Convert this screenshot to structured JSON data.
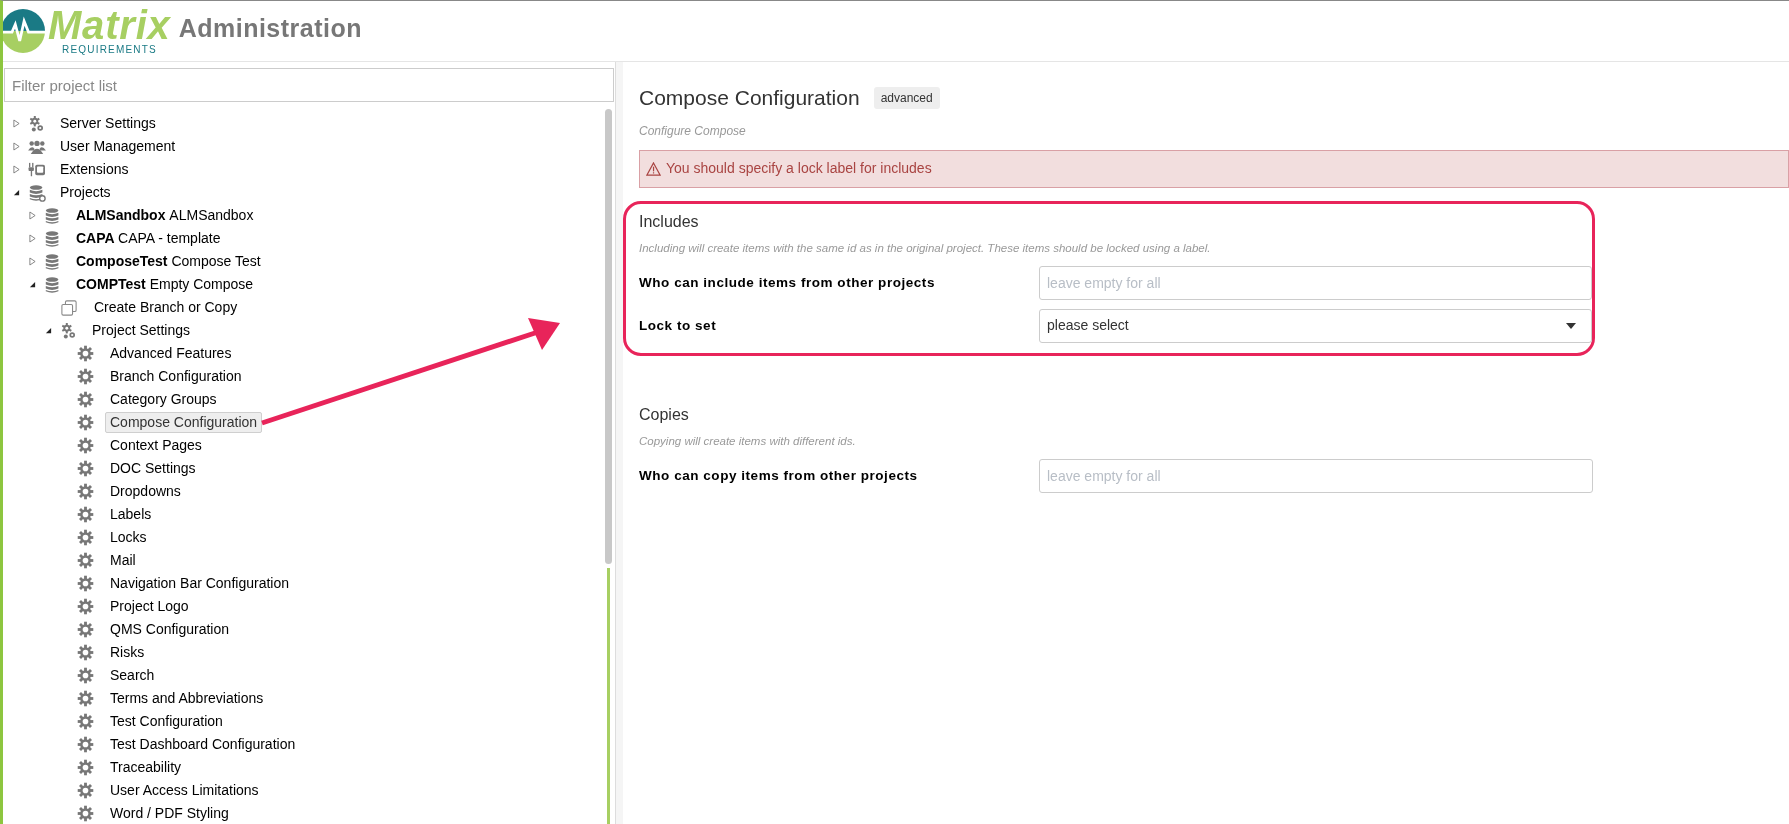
{
  "header": {
    "logo_word": "Matrix",
    "logo_sub": "REQUIREMENTS",
    "title": "Administration"
  },
  "sidebar": {
    "filter": {
      "placeholder": "Filter project list"
    },
    "tree": [
      {
        "kind": "gears",
        "label": "Server Settings",
        "expanded": false,
        "selected": false
      },
      {
        "kind": "users",
        "label": "User Management",
        "expanded": false,
        "selected": false
      },
      {
        "kind": "plug",
        "label": "Extensions",
        "expanded": false,
        "selected": false
      },
      {
        "kind": "database-gear",
        "label": "Projects",
        "expanded": true,
        "selected": false,
        "children": [
          {
            "kind": "database",
            "code": "ALMSandbox",
            "label": "ALMSandbox",
            "expanded": false,
            "selected": false
          },
          {
            "kind": "database",
            "code": "CAPA",
            "label": "CAPA - template",
            "expanded": false,
            "selected": false
          },
          {
            "kind": "database",
            "code": "ComposeTest",
            "label": "Compose Test",
            "expanded": false,
            "selected": false
          },
          {
            "kind": "database",
            "code": "COMPTest",
            "label": "Empty Compose",
            "expanded": true,
            "selected": false,
            "children": [
              {
                "kind": "copy",
                "label": "Create Branch or Copy",
                "selected": false
              },
              {
                "kind": "gears",
                "label": "Project Settings",
                "expanded": true,
                "selected": false,
                "children": [
                  {
                    "kind": "gear",
                    "label": "Advanced Features",
                    "selected": false
                  },
                  {
                    "kind": "gear",
                    "label": "Branch Configuration",
                    "selected": false
                  },
                  {
                    "kind": "gear",
                    "label": "Category Groups",
                    "selected": false
                  },
                  {
                    "kind": "gear",
                    "label": "Compose Configuration",
                    "selected": true
                  },
                  {
                    "kind": "gear",
                    "label": "Context Pages",
                    "selected": false
                  },
                  {
                    "kind": "gear",
                    "label": "DOC Settings",
                    "selected": false
                  },
                  {
                    "kind": "gear",
                    "label": "Dropdowns",
                    "selected": false
                  },
                  {
                    "kind": "gear",
                    "label": "Labels",
                    "selected": false
                  },
                  {
                    "kind": "gear",
                    "label": "Locks",
                    "selected": false
                  },
                  {
                    "kind": "gear",
                    "label": "Mail",
                    "selected": false
                  },
                  {
                    "kind": "gear",
                    "label": "Navigation Bar Configuration",
                    "selected": false
                  },
                  {
                    "kind": "gear",
                    "label": "Project Logo",
                    "selected": false
                  },
                  {
                    "kind": "gear",
                    "label": "QMS Configuration",
                    "selected": false
                  },
                  {
                    "kind": "gear",
                    "label": "Risks",
                    "selected": false
                  },
                  {
                    "kind": "gear",
                    "label": "Search",
                    "selected": false
                  },
                  {
                    "kind": "gear",
                    "label": "Terms and Abbreviations",
                    "selected": false
                  },
                  {
                    "kind": "gear",
                    "label": "Test Configuration",
                    "selected": false
                  },
                  {
                    "kind": "gear",
                    "label": "Test Dashboard Configuration",
                    "selected": false
                  },
                  {
                    "kind": "gear",
                    "label": "Traceability",
                    "selected": false
                  },
                  {
                    "kind": "gear",
                    "label": "User Access Limitations",
                    "selected": false
                  },
                  {
                    "kind": "gear",
                    "label": "Word / PDF Styling",
                    "selected": false
                  }
                ]
              }
            ]
          }
        ]
      }
    ]
  },
  "main": {
    "title": "Compose Configuration",
    "badge": "advanced",
    "subtitle": "Configure Compose",
    "alert": "You should specify a lock label for includes",
    "sections": [
      {
        "title": "Includes",
        "highlighted": true,
        "description": "Including will create items with the same id as in the original project. These items should be locked using a label.",
        "fields": [
          {
            "kind": "text",
            "label": "Who can include items from other projects",
            "placeholder": "leave empty for all"
          },
          {
            "kind": "select",
            "label": "Lock to set",
            "value": "please select"
          }
        ]
      },
      {
        "title": "Copies",
        "highlighted": false,
        "description": "Copying will create items with different ids.",
        "fields": [
          {
            "kind": "text",
            "label": "Who can copy items from other projects",
            "placeholder": "leave empty for all"
          }
        ]
      }
    ]
  }
}
